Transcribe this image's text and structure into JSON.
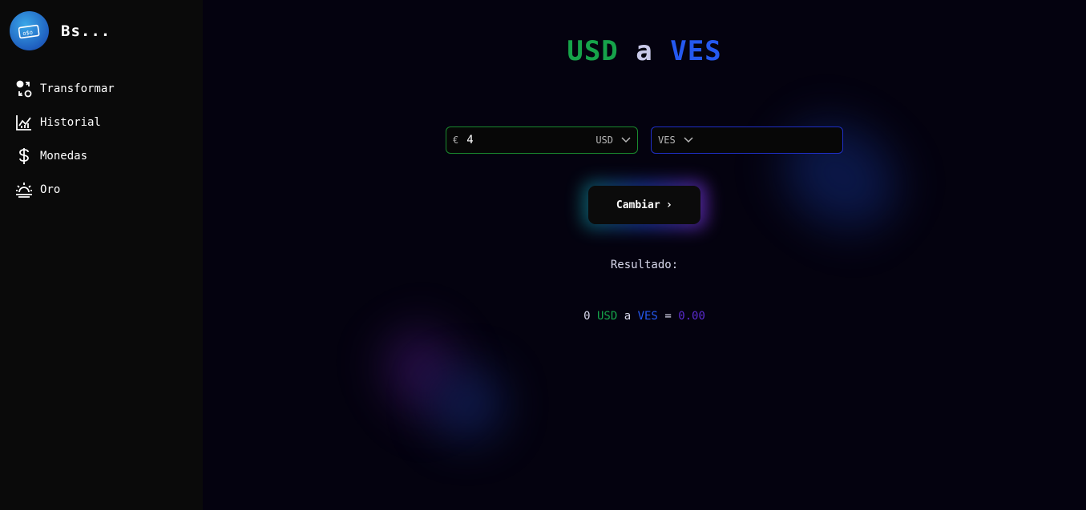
{
  "sidebar": {
    "brand": {
      "title": "Bs...",
      "logo_icon": "money-icon"
    },
    "items": [
      {
        "label": "Transformar",
        "icon": "exchange-icon"
      },
      {
        "label": "Historial",
        "icon": "chart-icon"
      },
      {
        "label": "Monedas",
        "icon": "dollar-icon"
      },
      {
        "label": "Oro",
        "icon": "sunrise-icon"
      }
    ]
  },
  "main": {
    "title": {
      "from": "USD",
      "connector": "a",
      "to": "VES"
    },
    "from_field": {
      "symbol": "€",
      "amount": "4",
      "currency": "USD"
    },
    "to_field": {
      "currency": "VES"
    },
    "convert_button": {
      "label": "Cambiar",
      "arrow": "›"
    },
    "result_label": "Resultado:",
    "result": {
      "amount": "0",
      "from": "USD",
      "connector": "a",
      "to": "VES",
      "equals": "=",
      "value": "0.00"
    }
  },
  "colors": {
    "green": "#16a34a",
    "blue": "#2559f0",
    "purple": "#5b2bd0",
    "background": "#04020f",
    "sidebar": "#0a0a0a"
  }
}
